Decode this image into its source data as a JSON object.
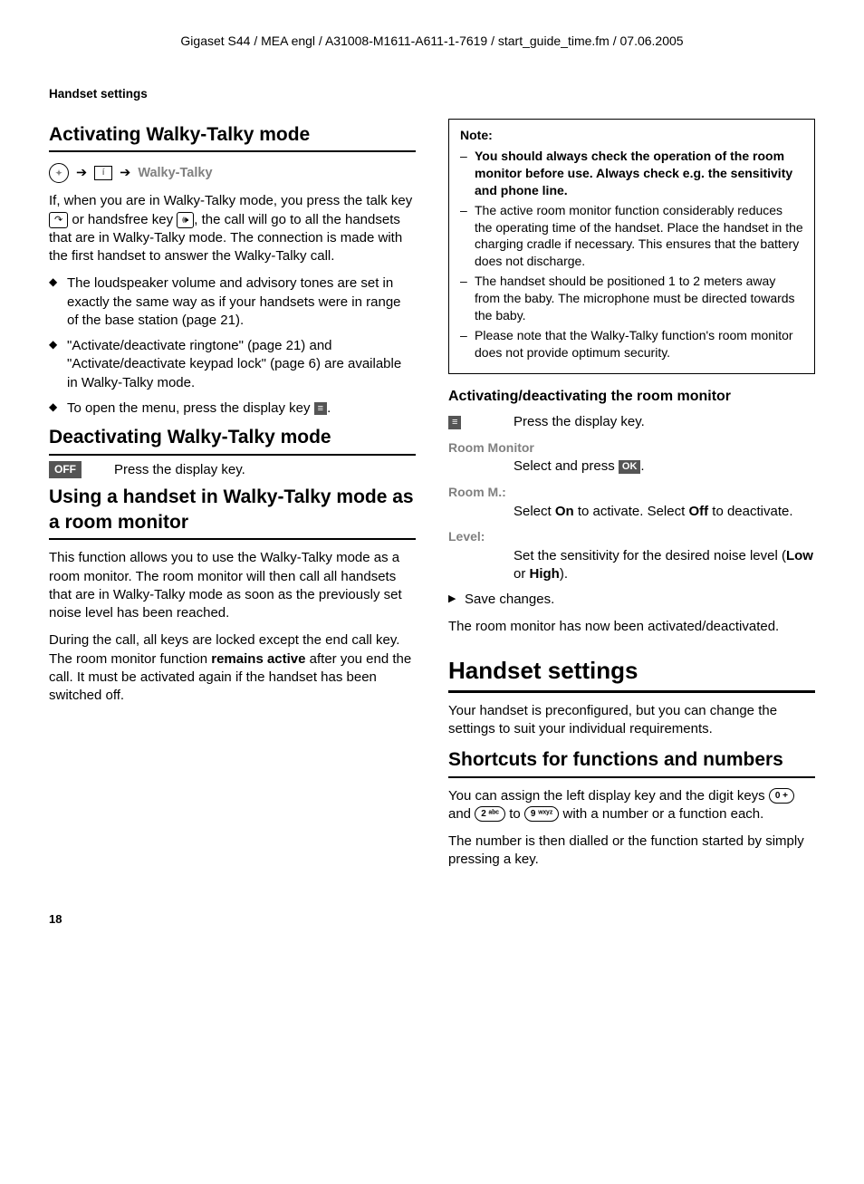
{
  "header": {
    "path": "Gigaset S44 / MEA engl / A31008-M1611-A611-1-7619 / start_guide_time.fm / 07.06.2005"
  },
  "breadcrumb": "Handset settings",
  "left": {
    "h2_activating": "Activating Walky-Talky mode",
    "nav_walky": "Walky-Talky",
    "p1a": "If, when you are in Walky-Talky mode, you press the talk key ",
    "p1b": " or handsfree key ",
    "p1c": ", the call will go to all the handsets that are in Walky-Talky mode. The connection is made with the first handset to answer the Walky-Talky call.",
    "bul1": "The loudspeaker volume and advisory tones are set in exactly the same way as if your handsets were in range of the base station (page 21).",
    "bul2": "\"Activate/deactivate ringtone\" (page 21) and \"Activate/deactivate keypad lock\" (page 6) are available in Walky-Talky mode.",
    "bul3a": "To open the menu, press the display key ",
    "bul3b": ".",
    "h2_deactivating": "Deactivating Walky-Talky mode",
    "off_label": "OFF",
    "off_text": "Press the display key.",
    "h2_using": "Using a handset in Walky-Talky mode as a room monitor",
    "p2": "This function allows you to use the Walky-Talky mode as a room monitor. The room monitor will then call all handsets that are in Walky-Talky mode as soon as the previously set noise level has been reached.",
    "p3a": "During the call, all keys are locked except the end call key. The room monitor function ",
    "p3_bold": "remains active",
    "p3b": " after you end the call. It must be activated again if the handset has been switched off."
  },
  "right": {
    "note_title": "Note:",
    "note1": "You should always check the operation of the room monitor before use. Always check e.g. the sensitivity and phone line.",
    "note2": "The active room monitor function considerably reduces the operating time of the handset. Place the handset in the charging cradle if necessary. This ensures that the battery does not discharge.",
    "note3": "The handset should be positioned 1 to 2 meters away from the baby. The microphone must be directed towards the baby.",
    "note4": "Please note that the Walky-Talky function's room monitor does not provide optimum security.",
    "h3_activating_room": "Activating/deactivating the room monitor",
    "press_display": "Press the display key.",
    "room_monitor_label": "Room Monitor",
    "select_press_a": "Select and press ",
    "select_press_b": ".",
    "ok_label": "OK",
    "room_m_label": "Room M.:",
    "room_m_text_a": "Select ",
    "room_m_on": "On",
    "room_m_text_b": " to activate. Select ",
    "room_m_off": "Off",
    "room_m_text_c": " to deactivate.",
    "level_label": "Level:",
    "level_text_a": "Set the sensitivity for the desired noise level (",
    "level_low": "Low",
    "level_text_b": " or ",
    "level_high": "High",
    "level_text_c": ").",
    "save_changes": "Save changes.",
    "room_activated": "The room monitor has now been activated/deactivated.",
    "h1_handset": "Handset settings",
    "p_handset": "Your handset is preconfigured, but you can change the settings to suit your individual requirements.",
    "h2_shortcuts": "Shortcuts for functions and numbers",
    "p_shortcuts_a": "You can assign the left display key and the digit keys ",
    "key0": "0 +",
    "p_shortcuts_b": " and ",
    "key2": "2 ᵃᵇᶜ",
    "p_shortcuts_c": " to ",
    "key9": "9 ʷˣʸᶻ",
    "p_shortcuts_d": " with a number or a function each.",
    "p_dial": "The number is then dialled or the function started by simply pressing a key."
  },
  "page_number": "18"
}
